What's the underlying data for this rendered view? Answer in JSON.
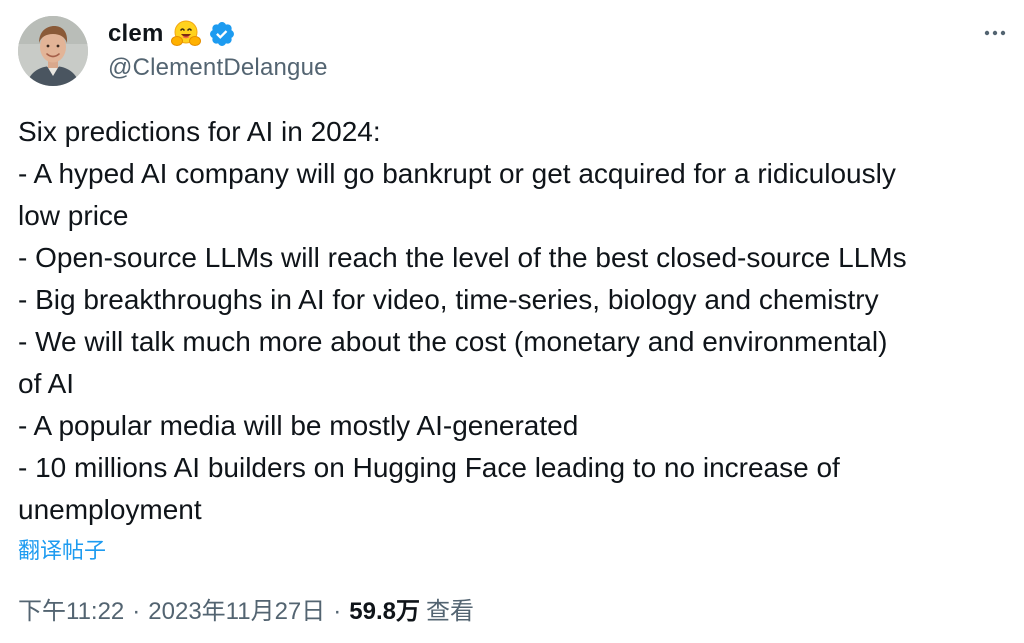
{
  "author": {
    "display_name": "clem",
    "emoji": "hugging-face-emoji",
    "verified_icon": "verified-badge-icon",
    "handle": "@ClementDelangue"
  },
  "menu": {
    "icon": "more-horizontal-icon"
  },
  "tweet": {
    "lines": [
      "Six predictions for AI in 2024:",
      "- A hyped AI company will go bankrupt or get acquired for a ridiculously",
      "low price",
      "- Open-source LLMs will reach the level of the best closed-source LLMs",
      "- Big breakthroughs in AI for video, time-series, biology and chemistry",
      "- We will talk much more about the cost (monetary and environmental)",
      "of AI",
      "- A popular media will be mostly AI-generated",
      "- 10 millions AI builders on Hugging Face leading to no increase of",
      "unemployment"
    ]
  },
  "translate_label": "翻译帖子",
  "meta": {
    "time": "下午11:22",
    "separator": "·",
    "date": "2023年11月27日",
    "views_count": "59.8万",
    "views_label": "查看"
  },
  "colors": {
    "text": "#0f1419",
    "secondary": "#536471",
    "link": "#1d9bf0",
    "verified": "#1d9bf0"
  }
}
